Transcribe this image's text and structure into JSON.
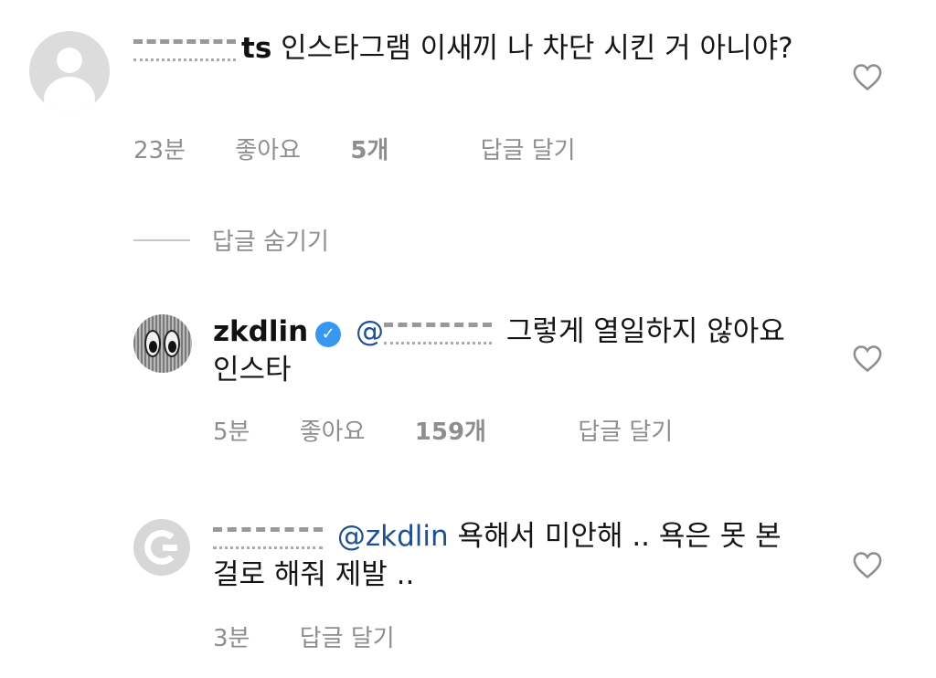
{
  "comments": [
    {
      "username_suffix": "ts",
      "text": "인스타그램 이새끼 나 차단 시킨 거 아니야?",
      "time": "23분",
      "likes_label": "좋아요",
      "likes_count": "5개",
      "reply_label": "답글 달기"
    },
    {
      "username": "zkdlin",
      "verified_icon": "verified-badge-icon",
      "mention_prefix": "@",
      "text": "그렇게 열일하지 않아요 인스타",
      "time": "5분",
      "likes_label": "좋아요",
      "likes_count": "159개",
      "reply_label": "답글 달기"
    },
    {
      "mention": "@zkdlin",
      "text": "욕해서 미안해 .. 욕은 못 본 걸로 해줘 제발 ..",
      "time": "3분",
      "reply_label": "답글 달기"
    }
  ],
  "hide_replies_label": "답글 숨기기",
  "colors": {
    "meta_gray": "#8e8e8e",
    "mention_blue": "#1d4f91",
    "verified_blue": "#3897f0"
  }
}
